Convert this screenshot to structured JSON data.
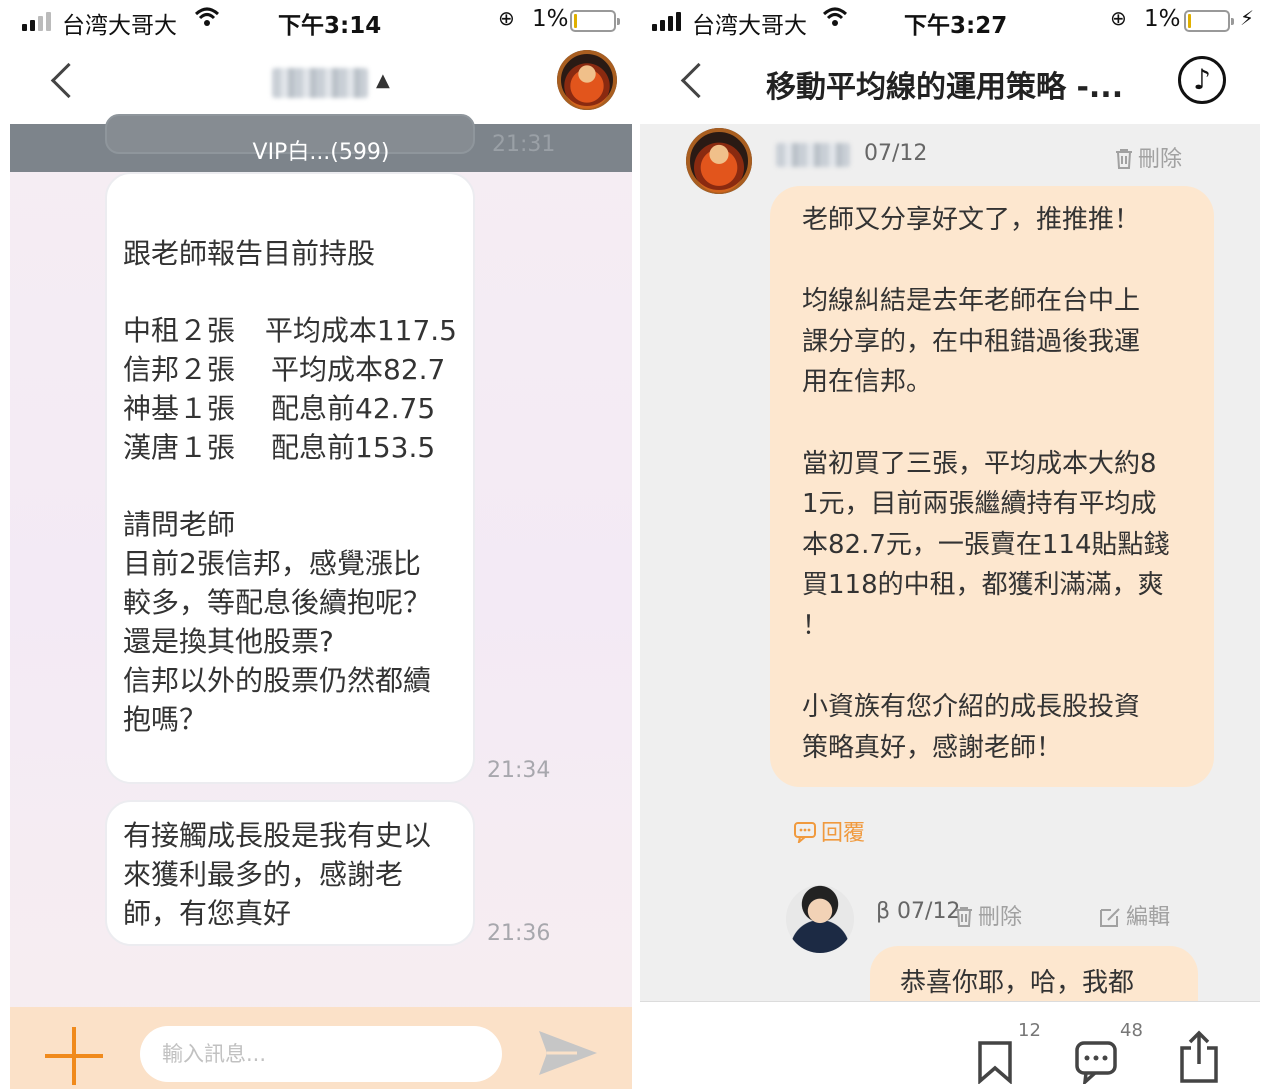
{
  "left": {
    "statusbar": {
      "carrier": "台湾大哥大",
      "time": "下午3:14",
      "battery": "1%",
      "battery_level": 0.01
    },
    "header": {
      "caret": "▲"
    },
    "pinned": {
      "label": "VIP白...(599)",
      "time": "21:31"
    },
    "messages": [
      {
        "lines": [
          "跟老師報告目前持股",
          "",
          [
            "中租２張",
            "平均成本117.5"
          ],
          [
            "信邦２張",
            "平均成本82.7"
          ],
          [
            "神基１張",
            "配息前42.75"
          ],
          [
            "漢唐１張",
            "配息前153.5"
          ],
          "",
          "請問老師",
          "目前2張信邦，感覺漲比",
          "較多，等配息後續抱呢？",
          "還是換其他股票?",
          "信邦以外的股票仍然都續",
          "抱嗎？"
        ],
        "time": "21:34"
      },
      {
        "lines": [
          "有接觸成長股是我有史以",
          "來獲利最多的，感謝老",
          "師，有您真好"
        ],
        "time": "21:36"
      }
    ],
    "input": {
      "placeholder": "輸入訊息..."
    },
    "colors": {
      "accent": "#f08a1c",
      "pinned_bg": "#7d848b"
    },
    "icons": {
      "back": "chevron-left-icon",
      "plus": "plus-icon",
      "send": "send-icon"
    }
  },
  "right": {
    "statusbar": {
      "carrier": "台湾大哥大",
      "time": "下午3:27",
      "battery": "1%",
      "battery_level": 0.01,
      "charging": "⚡"
    },
    "header": {
      "title": "移動平均線的運用策略 -...",
      "music_icon": "♪"
    },
    "post": {
      "date": "07/12",
      "delete_label": "刪除",
      "lines": [
        "老師又分享好文了，推推推！",
        "",
        "均線糾結是去年老師在台中上",
        "課分享的，在中租錯過後我運",
        "用在信邦。",
        "",
        "當初買了三張，平均成本大約8",
        "1元，目前兩張繼續持有平均成",
        "本82.7元，一張賣在114貼點錢",
        "買118的中租，都獲利滿滿，爽",
        "！",
        "",
        "小資族有您介紹的成長股投資",
        "策略真好，感謝老師！"
      ],
      "reply_label": "回覆"
    },
    "reply": {
      "date": "β 07/12",
      "delete_label": "刪除",
      "edit_label": "編輯",
      "text": "恭喜你耶，哈，我都"
    },
    "bottombar": {
      "bookmark_count": "12",
      "comment_count": "48"
    },
    "colors": {
      "bubble_bg": "#fde7cf",
      "reply_accent": "#f09a3e"
    },
    "icons": {
      "back": "chevron-left-icon",
      "music": "music-note-icon",
      "bookmark": "bookmark-icon",
      "comment": "comment-icon",
      "share": "share-icon",
      "trash": "trash-icon",
      "edit": "edit-icon"
    }
  }
}
